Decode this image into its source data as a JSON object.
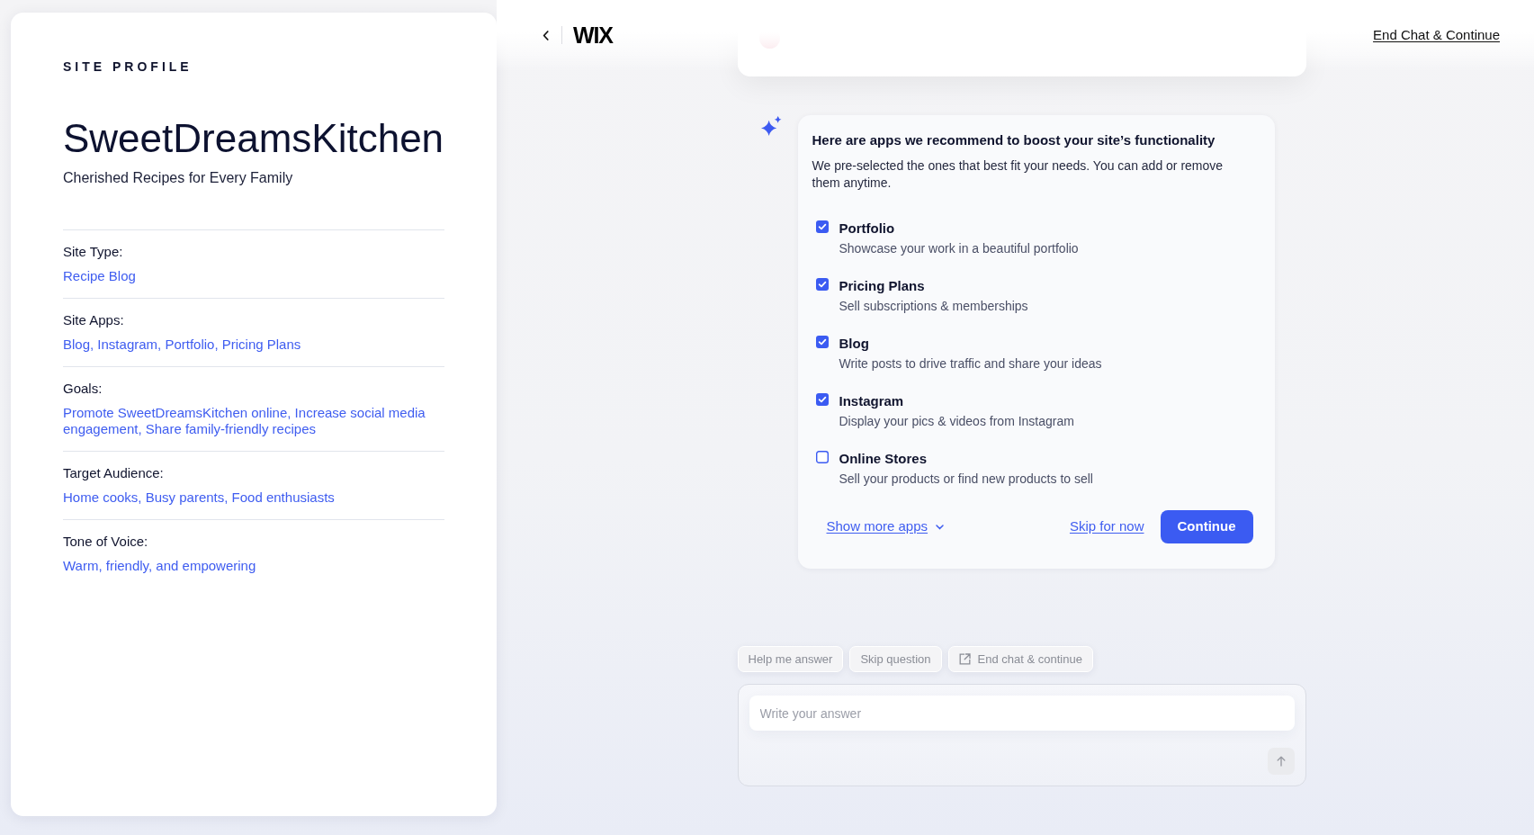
{
  "header": {
    "logo": "WIX",
    "end_chat_link": "End Chat & Continue"
  },
  "site_profile": {
    "heading": "SITE PROFILE",
    "site_name": "SweetDreamsKitchen",
    "tagline": "Cherished Recipes for Every Family",
    "fields": [
      {
        "label": "Site Type:",
        "value": "Recipe Blog"
      },
      {
        "label": "Site Apps:",
        "value": "Blog, Instagram, Portfolio, Pricing Plans"
      },
      {
        "label": "Goals:",
        "value": "Promote SweetDreamsKitchen online, Increase social media engagement, Share family-friendly recipes"
      },
      {
        "label": "Target Audience:",
        "value": "Home cooks, Busy parents, Food enthusiasts"
      },
      {
        "label": "Tone of Voice:",
        "value": "Warm, friendly, and empowering"
      }
    ]
  },
  "apps_prompt": {
    "title": "Here are apps we recommend to boost your site’s functionality",
    "description": "We pre-selected the ones that best fit your needs. You can add or remove them anytime.",
    "apps": [
      {
        "name": "Portfolio",
        "description": "Showcase your work in a beautiful portfolio",
        "checked": true
      },
      {
        "name": "Pricing Plans",
        "description": "Sell subscriptions & memberships",
        "checked": true
      },
      {
        "name": "Blog",
        "description": "Write posts to drive traffic and share your ideas",
        "checked": true
      },
      {
        "name": "Instagram",
        "description": "Display your pics & videos from Instagram",
        "checked": true
      },
      {
        "name": "Online Stores",
        "description": "Sell your products or find new products to sell",
        "checked": false
      }
    ],
    "show_more_link": "Show more apps",
    "skip_link": "Skip for now",
    "continue_button": "Continue"
  },
  "quick_replies": [
    {
      "label": "Help me answer",
      "kind": "plain"
    },
    {
      "label": "Skip question",
      "kind": "plain"
    },
    {
      "label": "End chat & continue",
      "kind": "external"
    }
  ],
  "composer": {
    "placeholder": "Write your answer"
  }
}
